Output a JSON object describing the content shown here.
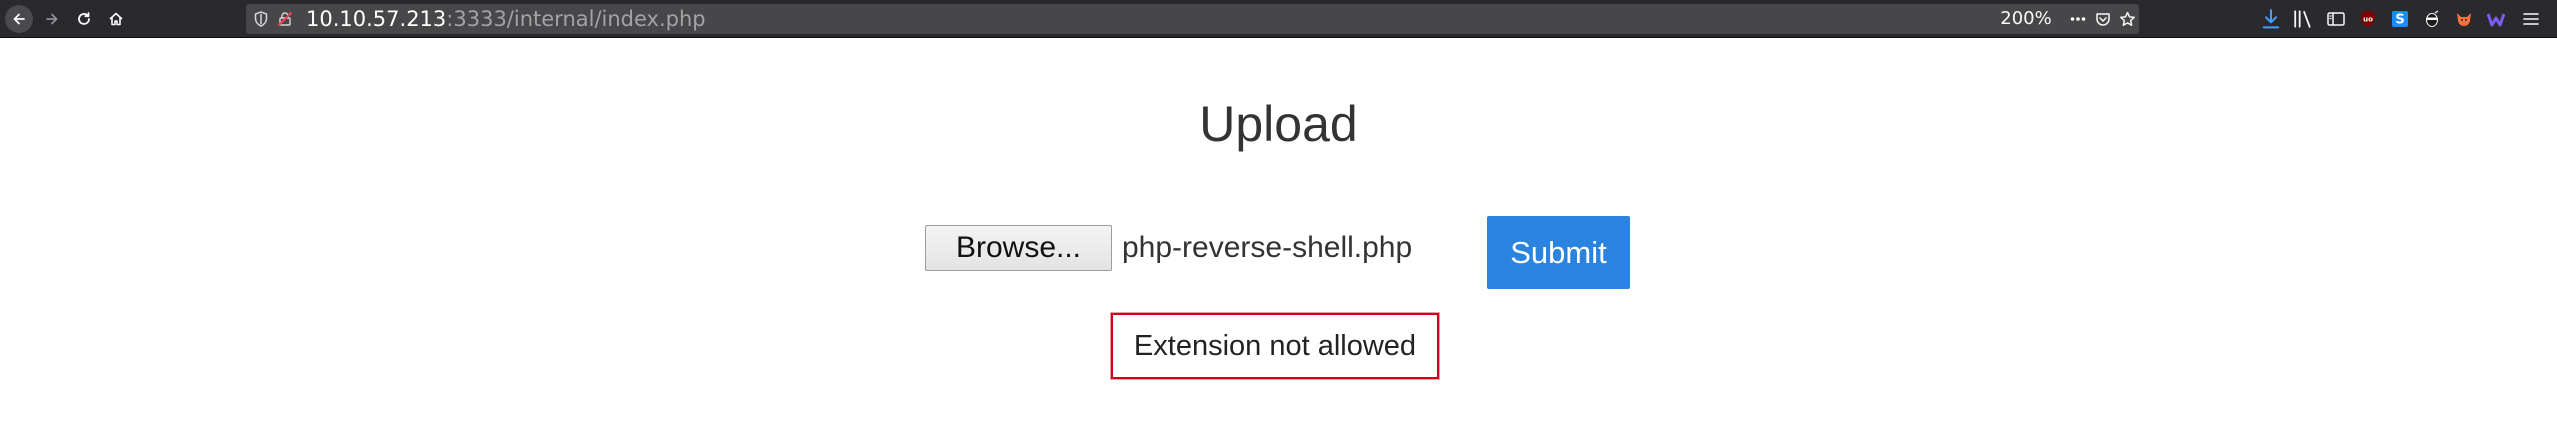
{
  "browser": {
    "url_host": "10.10.57.213",
    "url_rest": ":3333/internal/index.php",
    "zoom": "200%",
    "colors": {
      "toolbar_bg": "#2a2a2e",
      "urlbar_bg": "#474749",
      "download_icon": "#45a1ff"
    },
    "toolbar_icons": [
      "download-icon",
      "library-icon",
      "sidebar-icon",
      "ublock-icon",
      "extension-s-icon",
      "ninja-extension-icon",
      "foxyproxy-icon",
      "wappalyzer-icon",
      "menu-icon"
    ]
  },
  "page": {
    "title": "Upload",
    "browse_label": "Browse...",
    "file_name": "php-reverse-shell.php",
    "submit_label": "Submit",
    "error_message": "Extension not allowed",
    "colors": {
      "submit_bg": "#2b83e0",
      "error_border": "#d0021b"
    }
  }
}
